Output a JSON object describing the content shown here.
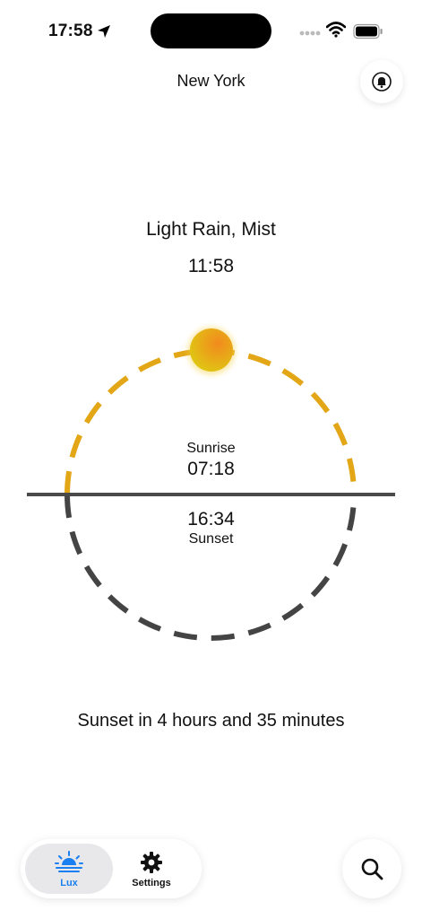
{
  "status_bar": {
    "time": "17:58"
  },
  "header": {
    "city": "New York"
  },
  "weather": {
    "condition": "Light Rain, Mist",
    "current_time": "11:58"
  },
  "sun": {
    "sunrise_label": "Sunrise",
    "sunrise_time": "07:18",
    "sunset_time": "16:34",
    "sunset_label": "Sunset"
  },
  "countdown": "Sunset in 4 hours and 35 minutes",
  "tabs": [
    {
      "label": "Lux",
      "icon": "sunrise-icon",
      "active": true
    },
    {
      "label": "Settings",
      "icon": "gear-icon",
      "active": false
    }
  ],
  "colors": {
    "day_arc": "#e2a616",
    "night_arc": "#444444",
    "accent": "#1a7ff0",
    "sun": "#f0a021"
  }
}
